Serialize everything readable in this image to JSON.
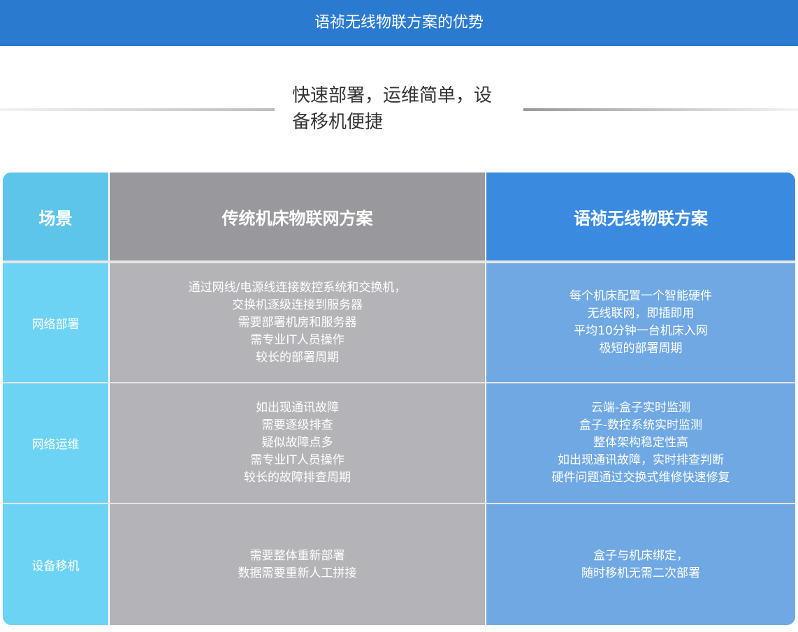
{
  "header": {
    "title": "语祯无线物联方案的优势"
  },
  "subtitle": {
    "line1": "快速部署，运维简单，设",
    "line2": "备移机便捷"
  },
  "table": {
    "headers": [
      "场景",
      "传统机床物联网方案",
      "语祯无线物联方案"
    ],
    "rows": [
      {
        "scene": "网络部署",
        "traditional": [
          "通过网线/电源线连接数控系统和交换机，",
          "交换机逐级连接到服务器",
          "需要部署机房和服务器",
          "需专业IT人员操作",
          "较长的部署周期"
        ],
        "wireless": [
          "每个机床配置一个智能硬件",
          "无线联网，即插即用",
          "平均10分钟一台机床入网",
          "极短的部署周期"
        ]
      },
      {
        "scene": "网络运维",
        "traditional": [
          "如出现通讯故障",
          "需要逐级排查",
          "疑似故障点多",
          "需专业IT人员操作",
          "较长的故障排查周期"
        ],
        "wireless": [
          "云端-盒子实时监测",
          "盒子-数控系统实时监测",
          "整体架构稳定性高",
          "如出现通讯故障，实时排查判断",
          "硬件问题通过交换式维修快速修复"
        ]
      },
      {
        "scene": "设备移机",
        "traditional": [
          "需要整体重新部署",
          "数据需要重新人工拼接"
        ],
        "wireless": [
          "盒子与机床绑定，",
          "随时移机无需二次部署"
        ]
      }
    ]
  }
}
